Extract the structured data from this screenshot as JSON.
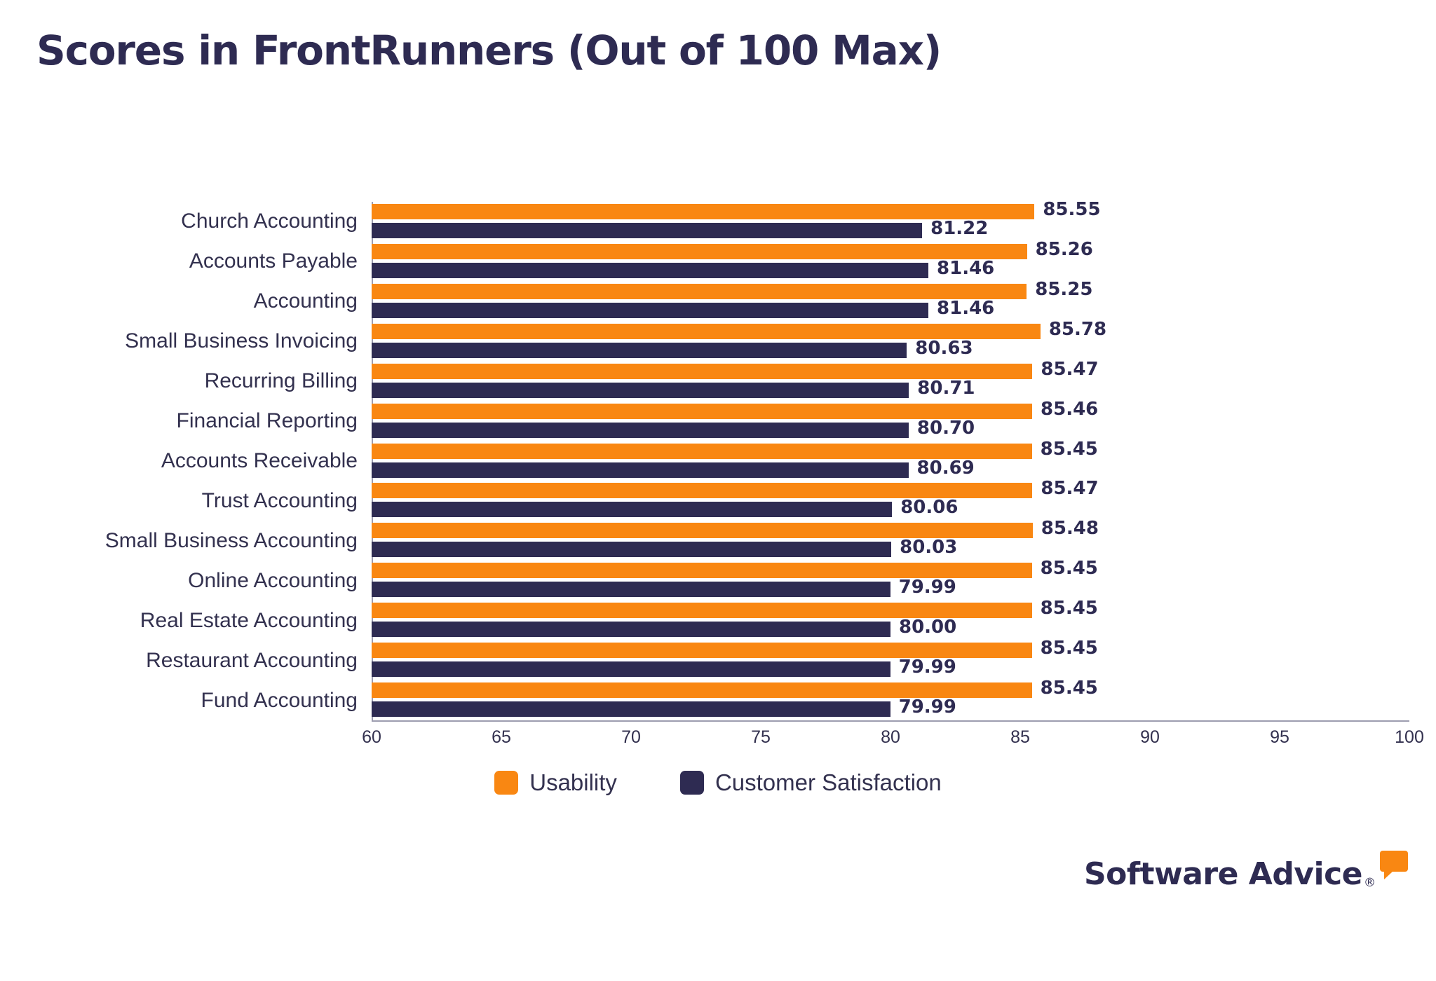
{
  "title": "Scores in FrontRunners (Out of 100 Max)",
  "logo": {
    "text": "Software Advice",
    "registered_mark": "®",
    "bubble_icon": "speech-bubble-icon"
  },
  "legend": {
    "position": "bottom-center",
    "items": [
      {
        "label": "Usability",
        "color": "#f98712"
      },
      {
        "label": "Customer Satisfaction",
        "color": "#2e2b52"
      }
    ]
  },
  "chart_data": {
    "type": "bar",
    "orientation": "horizontal",
    "title": "Scores in FrontRunners (Out of 100 Max)",
    "xlabel": "",
    "ylabel": "",
    "xlim": [
      60,
      100
    ],
    "xticks": [
      60,
      65,
      70,
      75,
      80,
      85,
      90,
      95,
      100
    ],
    "grid": false,
    "legend_position": "bottom-center",
    "categories": [
      "Church Accounting",
      "Accounts Payable",
      "Accounting",
      "Small Business Invoicing",
      "Recurring Billing",
      "Financial Reporting",
      "Accounts Receivable",
      "Trust Accounting",
      "Small Business Accounting",
      "Online Accounting",
      "Real Estate Accounting",
      "Restaurant Accounting",
      "Fund Accounting"
    ],
    "series": [
      {
        "name": "Usability",
        "color": "#f98712",
        "values": [
          85.55,
          85.26,
          85.25,
          85.78,
          85.47,
          85.46,
          85.45,
          85.47,
          85.48,
          85.45,
          85.45,
          85.45,
          85.45
        ],
        "labels": [
          "85.55",
          "85.26",
          "85.25",
          "85.78",
          "85.47",
          "85.46",
          "85.45",
          "85.47",
          "85.48",
          "85.45",
          "85.45",
          "85.45",
          "85.45"
        ]
      },
      {
        "name": "Customer Satisfaction",
        "color": "#2e2b52",
        "values": [
          81.22,
          81.46,
          81.46,
          80.63,
          80.71,
          80.7,
          80.69,
          80.06,
          80.03,
          79.99,
          80.0,
          79.99,
          79.99
        ],
        "labels": [
          "81.22",
          "81.46",
          "81.46",
          "80.63",
          "80.71",
          "80.70",
          "80.69",
          "80.06",
          "80.03",
          "79.99",
          "80.00",
          "79.99",
          "79.99"
        ]
      }
    ]
  }
}
